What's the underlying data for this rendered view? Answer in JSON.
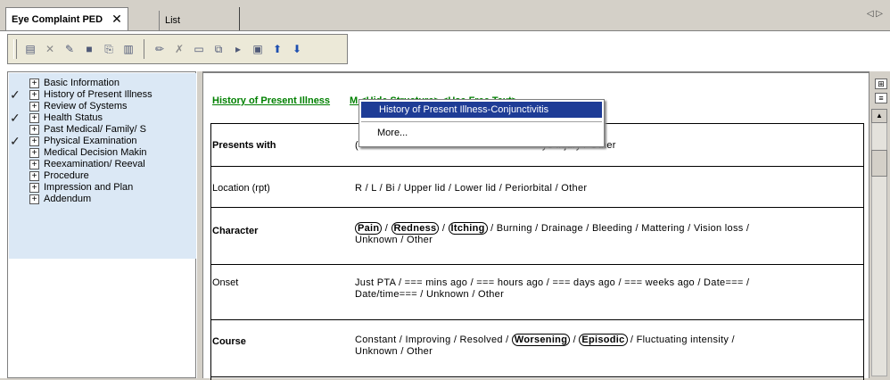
{
  "tabs": {
    "active": "Eye Complaint PED",
    "close": "✕",
    "second": "List",
    "scroll": "◁ ▷"
  },
  "toolbar_icons": [
    "note-icon",
    "delete-icon",
    "pin-icon",
    "folder-icon",
    "link-icon",
    "document-icon",
    "pencil-icon",
    "erase-icon",
    "clipboard-icon",
    "copy-icon",
    "play-icon",
    "save-icon",
    "up-arrow-icon",
    "down-arrow-icon"
  ],
  "tree": {
    "items": [
      {
        "label": "Basic Information",
        "checked": false
      },
      {
        "label": "History of Present Illness",
        "checked": true
      },
      {
        "label": "Review of Systems",
        "checked": false
      },
      {
        "label": "Health Status",
        "checked": true
      },
      {
        "label": "Past Medical/ Family/ S",
        "checked": false
      },
      {
        "label": "Physical Examination",
        "checked": true
      },
      {
        "label": "Medical Decision Makin",
        "checked": false
      },
      {
        "label": "Reexamination/ Reeval",
        "checked": false
      },
      {
        "label": "Procedure",
        "checked": false
      },
      {
        "label": "Impression and Plan",
        "checked": false
      },
      {
        "label": "Addendum",
        "checked": false
      }
    ],
    "check_glyph": "✓",
    "expand_glyph": "+"
  },
  "main": {
    "header": "History of Present Illness",
    "header_links": "M <Hide Structure> <Use Free Text>",
    "rows": {
      "presents_label": "Presents with",
      "presents_value_pre": "(",
      "presents_value_post": "ye injury  /  Other",
      "location_label": "Location (rpt)",
      "location_value": "R  /  L  /  Bi  /  Upper lid  /  Lower lid  /  Periorbital  /  Other",
      "character_label": "Character",
      "char_pain": "Pain",
      "char_redness": "Redness",
      "char_itching": "Itching",
      "character_rest": "/  Burning  /  Drainage  /  Bleeding  /  Mattering  /  Vision loss  /",
      "character_line2": "Unknown  /  Other",
      "onset_label": "Onset",
      "onset_line1": "Just PTA  /  === mins ago  /  === hours ago  /  === days ago  /  === weeks ago  /  Date===  /",
      "onset_line2": "Date/time===  /  Unknown  /  Other",
      "course_label": "Course",
      "course_pre": "Constant  /  Improving  /  Resolved  /",
      "course_worsening": "Worsening",
      "course_episodic": "Episodic",
      "course_post": "/  Fluctuating intensity  /",
      "course_line2": "Unknown  /  Other"
    }
  },
  "popup": {
    "item1": "History of Present Illness-Conjunctivitis",
    "item2": "More..."
  },
  "scrollbar": {
    "up": "▲"
  }
}
